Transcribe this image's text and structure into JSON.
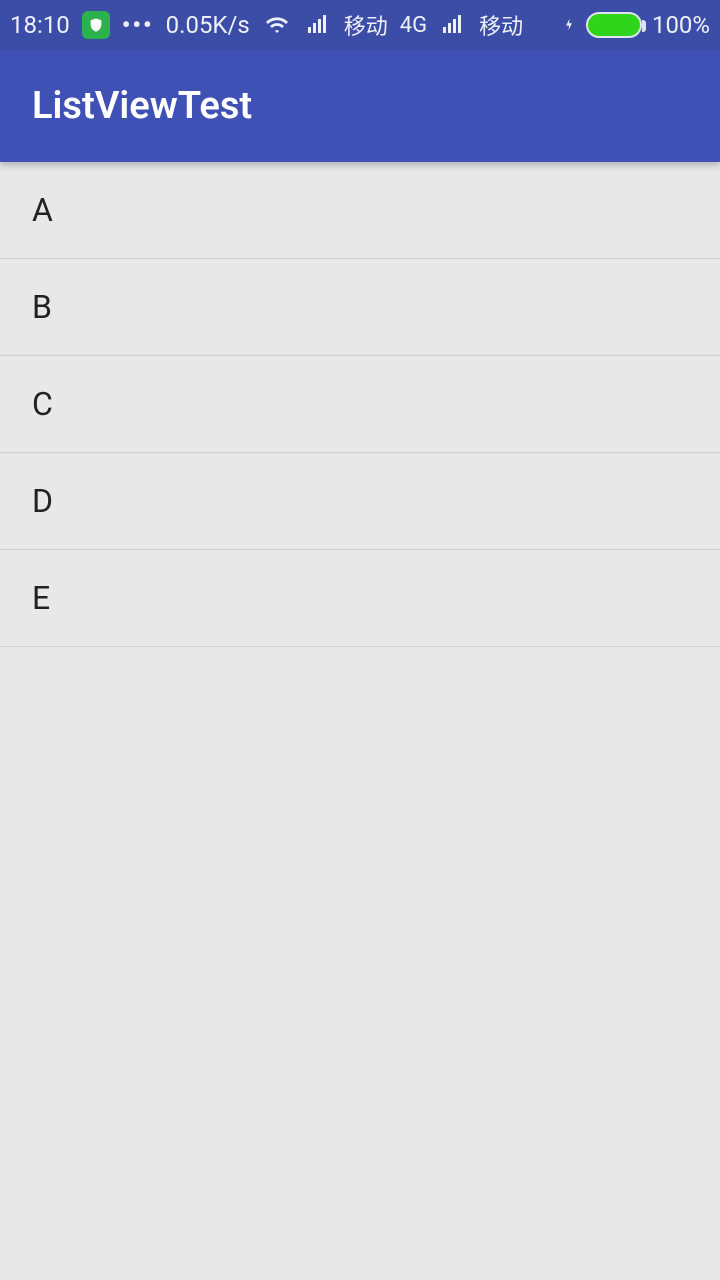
{
  "status": {
    "time": "18:10",
    "speed": "0.05K/s",
    "carrier1": "移动",
    "net": "4G",
    "carrier2": "移动",
    "battery_pct": "100%"
  },
  "app": {
    "title": "ListViewTest"
  },
  "list": {
    "items": [
      "A",
      "B",
      "C",
      "D",
      "E"
    ]
  }
}
